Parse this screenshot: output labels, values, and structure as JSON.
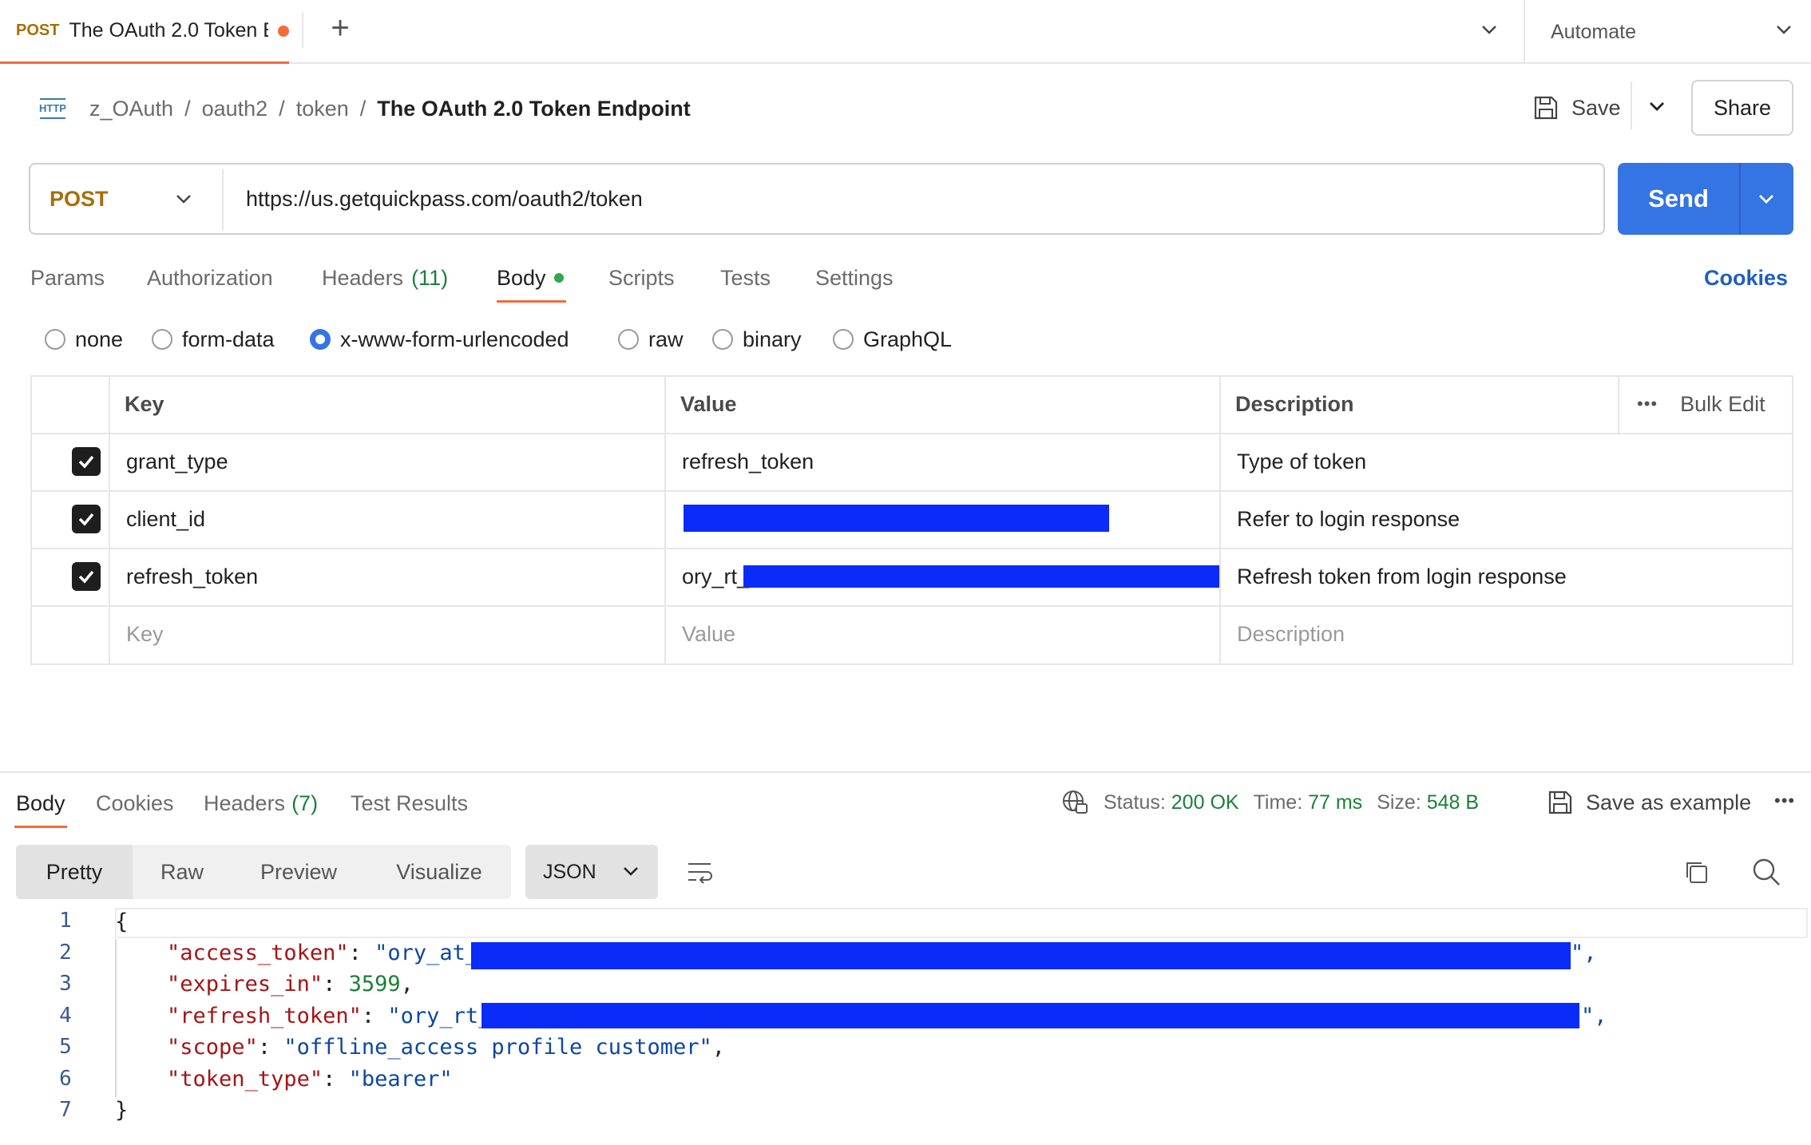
{
  "top_tab": {
    "method": "POST",
    "title": "The OAuth 2.0 Token Endpoint"
  },
  "environment": "Automate",
  "breadcrumb": {
    "http_icon": "HTTP",
    "items": [
      "z_OAuth",
      "oauth2",
      "token"
    ],
    "current": "The OAuth 2.0 Token Endpoint",
    "sep": "/"
  },
  "toolbar": {
    "save_label": "Save",
    "share_label": "Share"
  },
  "request": {
    "method": "POST",
    "url": "https://us.getquickpass.com/oauth2/token",
    "send_label": "Send"
  },
  "request_tabs": [
    {
      "label": "Params"
    },
    {
      "label": "Authorization"
    },
    {
      "label": "Headers",
      "count": "(11)"
    },
    {
      "label": "Body"
    },
    {
      "label": "Scripts"
    },
    {
      "label": "Tests"
    },
    {
      "label": "Settings"
    }
  ],
  "cookies_label": "Cookies",
  "body_types": [
    "none",
    "form-data",
    "x-www-form-urlencoded",
    "raw",
    "binary",
    "GraphQL"
  ],
  "body_type_selected": "x-www-form-urlencoded",
  "table": {
    "headers": {
      "key": "Key",
      "value": "Value",
      "description": "Description",
      "bulk_edit": "Bulk Edit"
    },
    "rows": [
      {
        "checked": true,
        "key": "grant_type",
        "value": "refresh_token",
        "description": "Type of token"
      },
      {
        "checked": true,
        "key": "client_id",
        "value": "",
        "description": "Refer to login response"
      },
      {
        "checked": true,
        "key": "refresh_token",
        "value": "ory_rt_",
        "description": "Refresh token from login response"
      }
    ],
    "placeholders": {
      "key": "Key",
      "value": "Value",
      "description": "Description"
    }
  },
  "response": {
    "tabs": [
      {
        "label": "Body"
      },
      {
        "label": "Cookies"
      },
      {
        "label": "Headers",
        "count": "(7)"
      },
      {
        "label": "Test Results"
      }
    ],
    "status_label": "Status:",
    "status": "200 OK",
    "time_label": "Time:",
    "time": "77 ms",
    "size_label": "Size:",
    "size": "548 B",
    "save_example": "Save as example",
    "views": [
      "Pretty",
      "Raw",
      "Preview",
      "Visualize"
    ],
    "format": "JSON",
    "line_numbers": [
      "1",
      "2",
      "3",
      "4",
      "5",
      "6",
      "7"
    ],
    "json": {
      "open": "{",
      "access_token_key": "\"access_token\"",
      "access_token_val": "\"ory_at_",
      "expires_in_key": "\"expires_in\"",
      "expires_in_val": "3599",
      "refresh_token_key": "\"refresh_token\"",
      "refresh_token_val": "\"ory_rt_",
      "scope_key": "\"scope\"",
      "scope_val": "\"offline_access profile customer\"",
      "token_type_key": "\"token_type\"",
      "token_type_val": "\"bearer\"",
      "close": "}"
    }
  },
  "colors": {
    "accent_orange": "#f26b3a",
    "send_blue": "#3574e3",
    "method_gold": "#a86d09",
    "redaction_blue": "#0b2bf8",
    "success_green": "#1b7f3a"
  }
}
